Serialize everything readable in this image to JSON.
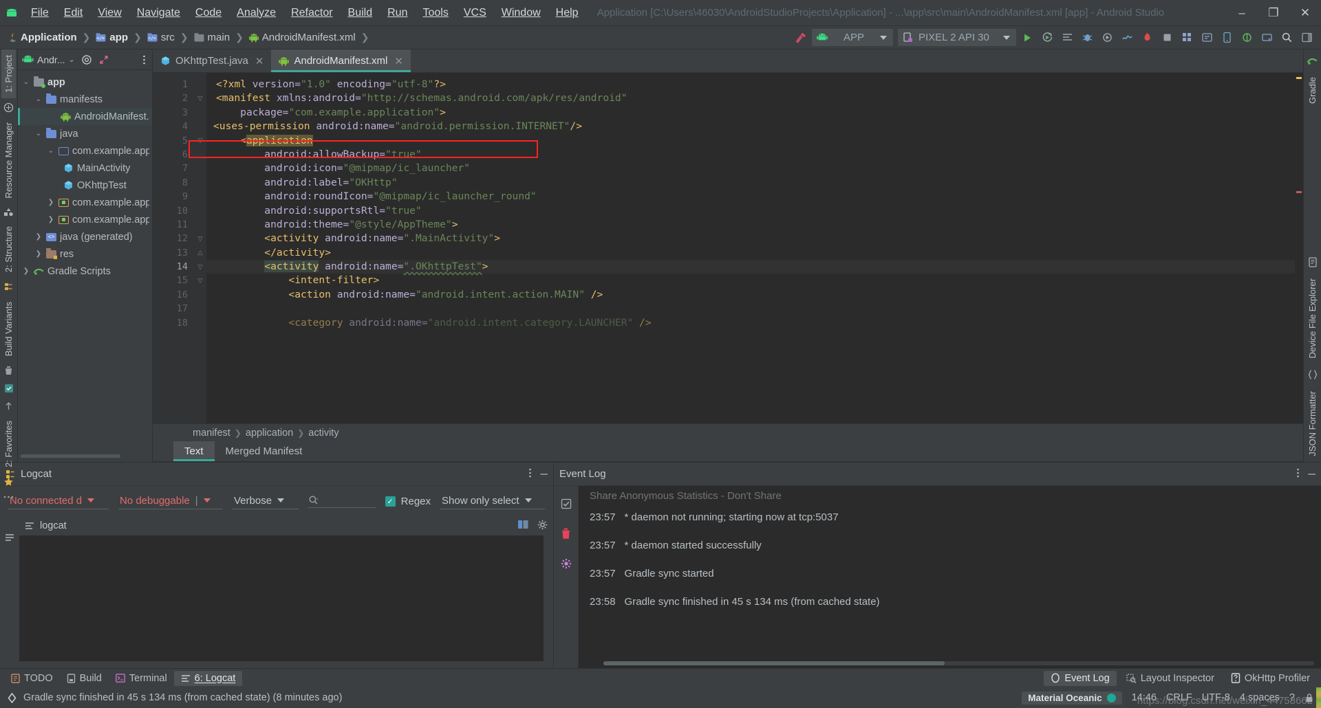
{
  "window": {
    "title": "Application [C:\\Users\\46030\\AndroidStudioProjects\\Application] - ...\\app\\src\\main\\AndroidManifest.xml [app] - Android Studio",
    "minimize": "–",
    "maximize": "❐",
    "close": "✕"
  },
  "menu": [
    "File",
    "Edit",
    "View",
    "Navigate",
    "Code",
    "Analyze",
    "Refactor",
    "Build",
    "Run",
    "Tools",
    "VCS",
    "Window",
    "Help"
  ],
  "breadcrumbs": [
    {
      "label": "Application",
      "icon": "java-icon",
      "bold": true
    },
    {
      "label": "app",
      "icon": "module-icon",
      "bold": true
    },
    {
      "label": "src",
      "icon": "module-icon",
      "bold": false
    },
    {
      "label": "main",
      "icon": "folder-icon",
      "bold": false
    },
    {
      "label": "AndroidManifest.xml",
      "icon": "android-icon",
      "bold": false
    }
  ],
  "toolbar": {
    "run_config": "APP",
    "device": "PIXEL 2 API 30",
    "hammer_title": "Make Project"
  },
  "project_panel": {
    "title": "Andr...",
    "tree": [
      {
        "label": "app",
        "indent": 0,
        "arrow": "v",
        "icon": "folder-module",
        "bold": true,
        "selected": false
      },
      {
        "label": "manifests",
        "indent": 1,
        "arrow": "v",
        "icon": "folder-blue",
        "bold": false,
        "selected": false
      },
      {
        "label": "AndroidManifest.xml",
        "indent": 2,
        "arrow": "",
        "icon": "android",
        "bold": false,
        "selected": true
      },
      {
        "label": "java",
        "indent": 1,
        "arrow": "v",
        "icon": "folder-blue",
        "bold": false,
        "selected": false
      },
      {
        "label": "com.example.applic",
        "indent": 2,
        "arrow": "v",
        "icon": "package",
        "bold": false,
        "selected": false
      },
      {
        "label": "MainActivity",
        "indent": 3,
        "arrow": "",
        "icon": "class",
        "bold": false,
        "selected": false
      },
      {
        "label": "OKhttpTest",
        "indent": 3,
        "arrow": "",
        "icon": "class",
        "bold": false,
        "selected": false
      },
      {
        "label": "com.example.applic",
        "indent": 2,
        "arrow": ">",
        "icon": "package-test",
        "bold": false,
        "selected": false
      },
      {
        "label": "com.example.applic",
        "indent": 2,
        "arrow": ">",
        "icon": "package-test",
        "bold": false,
        "selected": false
      },
      {
        "label": "java (generated)",
        "indent": 1,
        "arrow": ">",
        "icon": "folder-generated",
        "bold": false,
        "selected": false
      },
      {
        "label": "res",
        "indent": 1,
        "arrow": ">",
        "icon": "folder-res",
        "bold": false,
        "selected": false
      },
      {
        "label": "Gradle Scripts",
        "indent": 0,
        "arrow": ">",
        "icon": "gradle",
        "bold": false,
        "selected": false
      }
    ]
  },
  "left_rail": [
    "1: Project",
    "Resource Manager"
  ],
  "left_rail_bottom": [
    "2: Structure",
    "Build Variants",
    "2: Favorites"
  ],
  "right_rail": [
    "Gradle",
    "Device File Explorer",
    "JSON Formatter"
  ],
  "editor": {
    "tabs": [
      {
        "label": "OKhttpTest.java",
        "icon": "class-icon",
        "active": false
      },
      {
        "label": "AndroidManifest.xml",
        "icon": "android-icon",
        "active": true
      }
    ],
    "lines": [
      {
        "n": 1,
        "fold": "",
        "highlight": false,
        "tokens": [
          {
            "t": "<?xml ",
            "c": "tagc"
          },
          {
            "t": "version=",
            "c": "attrc"
          },
          {
            "t": "\"1.0\"",
            "c": "strc"
          },
          {
            "t": " ",
            "c": "plain"
          },
          {
            "t": "encoding=",
            "c": "attrc"
          },
          {
            "t": "\"utf-8\"",
            "c": "strc"
          },
          {
            "t": "?>",
            "c": "tagc"
          }
        ]
      },
      {
        "n": 2,
        "fold": "-",
        "highlight": false,
        "tokens": [
          {
            "t": "<manifest ",
            "c": "tagc"
          },
          {
            "t": "xmlns:android=",
            "c": "attrc"
          },
          {
            "t": "\"http://schemas.android.com/apk/res/android\"",
            "c": "strc"
          }
        ]
      },
      {
        "n": 3,
        "fold": "",
        "highlight": false,
        "tokens": [
          {
            "t": "    ",
            "c": "plain"
          },
          {
            "t": "package=",
            "c": "attrc"
          },
          {
            "t": "\"com.example.application\"",
            "c": "strc"
          },
          {
            "t": ">",
            "c": "tagc"
          }
        ]
      },
      {
        "n": 4,
        "fold": "",
        "highlight": false,
        "tokens": [
          {
            "t": "<uses-permission ",
            "c": "tagc"
          },
          {
            "t": "android:name=",
            "c": "attrc"
          },
          {
            "t": "\"android.permission.INTERNET\"",
            "c": "strc"
          },
          {
            "t": "/>",
            "c": "tagc"
          }
        ]
      },
      {
        "n": 5,
        "fold": "-",
        "highlight": false,
        "tokens": [
          {
            "t": "    <",
            "c": "tagc"
          },
          {
            "t": "application",
            "c": "tagc",
            "box": "hl2"
          }
        ]
      },
      {
        "n": 6,
        "fold": "",
        "highlight": false,
        "tokens": [
          {
            "t": "        ",
            "c": "plain"
          },
          {
            "t": "android:allowBackup=",
            "c": "attrc"
          },
          {
            "t": "\"true\"",
            "c": "strc"
          }
        ]
      },
      {
        "n": 7,
        "fold": "",
        "highlight": false,
        "tokens": [
          {
            "t": "        ",
            "c": "plain"
          },
          {
            "t": "android:icon=",
            "c": "attrc"
          },
          {
            "t": "\"@mipmap/ic_launcher\"",
            "c": "strc"
          }
        ]
      },
      {
        "n": 8,
        "fold": "",
        "highlight": false,
        "tokens": [
          {
            "t": "        ",
            "c": "plain"
          },
          {
            "t": "android:label=",
            "c": "attrc"
          },
          {
            "t": "\"OKHttp\"",
            "c": "strc"
          }
        ]
      },
      {
        "n": 9,
        "fold": "",
        "highlight": false,
        "tokens": [
          {
            "t": "        ",
            "c": "plain"
          },
          {
            "t": "android:roundIcon=",
            "c": "attrc"
          },
          {
            "t": "\"@mipmap/ic_launcher_round\"",
            "c": "strc"
          }
        ]
      },
      {
        "n": 10,
        "fold": "",
        "highlight": false,
        "tokens": [
          {
            "t": "        ",
            "c": "plain"
          },
          {
            "t": "android:supportsRtl=",
            "c": "attrc"
          },
          {
            "t": "\"true\"",
            "c": "strc"
          }
        ]
      },
      {
        "n": 11,
        "fold": "",
        "highlight": false,
        "tokens": [
          {
            "t": "        ",
            "c": "plain"
          },
          {
            "t": "android:theme=",
            "c": "attrc"
          },
          {
            "t": "\"@style/AppTheme\"",
            "c": "strc"
          },
          {
            "t": ">",
            "c": "tagc"
          }
        ]
      },
      {
        "n": 12,
        "fold": "-",
        "highlight": false,
        "tokens": [
          {
            "t": "        <activity ",
            "c": "tagc"
          },
          {
            "t": "android:name=",
            "c": "attrc"
          },
          {
            "t": "\".MainActivity\"",
            "c": "strc"
          },
          {
            "t": ">",
            "c": "tagc"
          }
        ]
      },
      {
        "n": 13,
        "fold": "=",
        "highlight": false,
        "tokens": [
          {
            "t": "        </activity>",
            "c": "tagc"
          }
        ]
      },
      {
        "n": 14,
        "fold": "-",
        "highlight": true,
        "tokens": [
          {
            "t": "        ",
            "c": "plain"
          },
          {
            "t": "<activity",
            "c": "tagc",
            "box": "hl1"
          },
          {
            "t": " ",
            "c": "plain"
          },
          {
            "t": "android:name=",
            "c": "attrc"
          },
          {
            "t": "\".OKhttpTest\"",
            "c": "strc",
            "squig": true
          },
          {
            "t": ">",
            "c": "tagc"
          }
        ]
      },
      {
        "n": 15,
        "fold": "-",
        "highlight": false,
        "tokens": [
          {
            "t": "            <intent-filter>",
            "c": "tagc"
          }
        ]
      },
      {
        "n": 16,
        "fold": "",
        "highlight": false,
        "tokens": [
          {
            "t": "            <action ",
            "c": "tagc"
          },
          {
            "t": "android:name=",
            "c": "attrc"
          },
          {
            "t": "\"android.intent.action.MAIN\"",
            "c": "strc"
          },
          {
            "t": " />",
            "c": "tagc"
          }
        ]
      },
      {
        "n": 17,
        "fold": "",
        "highlight": false,
        "tokens": [
          {
            "t": "",
            "c": "plain"
          }
        ]
      },
      {
        "n": 18,
        "fold": "",
        "highlight": false,
        "tokens": [
          {
            "t": "            <category ",
            "c": "tagc"
          },
          {
            "t": "android:name=",
            "c": "attrc"
          },
          {
            "t": "\"android.intent.category.LAUNCHER\"",
            "c": "strc"
          },
          {
            "t": " />",
            "c": "tagc"
          }
        ]
      }
    ],
    "structure_breadcrumb": [
      "manifest",
      "application",
      "activity"
    ],
    "design_tabs": [
      {
        "label": "Text",
        "active": true
      },
      {
        "label": "Merged Manifest",
        "active": false
      }
    ]
  },
  "logcat": {
    "title": "Logcat",
    "device_filter": "No connected d",
    "process_filter": "No debuggable",
    "level_filter": "Verbose",
    "search_placeholder": "",
    "regex_label": "Regex",
    "scope_filter": "Show only select",
    "tag_label": "logcat"
  },
  "event_log": {
    "title": "Event Log",
    "entries": [
      {
        "time": "",
        "text": "Share Anonymous Statistics - Don't Share",
        "faint": true
      },
      {
        "time": "23:57",
        "text": "* daemon not running; starting now at tcp:5037",
        "faint": false
      },
      {
        "time": "23:57",
        "text": "* daemon started successfully",
        "faint": false
      },
      {
        "time": "23:57",
        "text": "Gradle sync started",
        "faint": false
      },
      {
        "time": "23:58",
        "text": "Gradle sync finished in 45 s 134 ms (from cached state)",
        "faint": false
      }
    ]
  },
  "tool_windows_bottom": [
    {
      "label": "TODO",
      "icon": "todo-icon",
      "active": false,
      "accel": ""
    },
    {
      "label": "Build",
      "icon": "build-icon",
      "active": false,
      "accel": ""
    },
    {
      "label": "Terminal",
      "icon": "terminal-icon",
      "active": false,
      "accel": ""
    },
    {
      "label": "6: Logcat",
      "icon": "logcat-icon",
      "active": true,
      "accel": "6"
    }
  ],
  "tool_windows_right": [
    {
      "label": "Event Log",
      "icon": "event-log-icon",
      "active": true
    },
    {
      "label": "Layout Inspector",
      "icon": "layout-inspector-icon",
      "active": false
    },
    {
      "label": "OkHttp Profiler",
      "icon": "okhttp-profiler-icon",
      "active": false
    }
  ],
  "status": {
    "message": "Gradle sync finished in 45 s 134 ms (from cached state) (8 minutes ago)",
    "theme": "Material Oceanic",
    "position": "14:46",
    "line_sep": "CRLF",
    "encoding": "UTF-8",
    "indent": "4 spaces",
    "branch": "?",
    "watermark": "https://blog.csdn.net/weixin_44758662"
  },
  "colors": {
    "accent_teal": "#3ba99c",
    "error_red": "#e06c6c",
    "highlight_red": "#ff2222",
    "tag": "#e8bf6a",
    "attr": "#bcb0d8",
    "string": "#6a8759"
  }
}
